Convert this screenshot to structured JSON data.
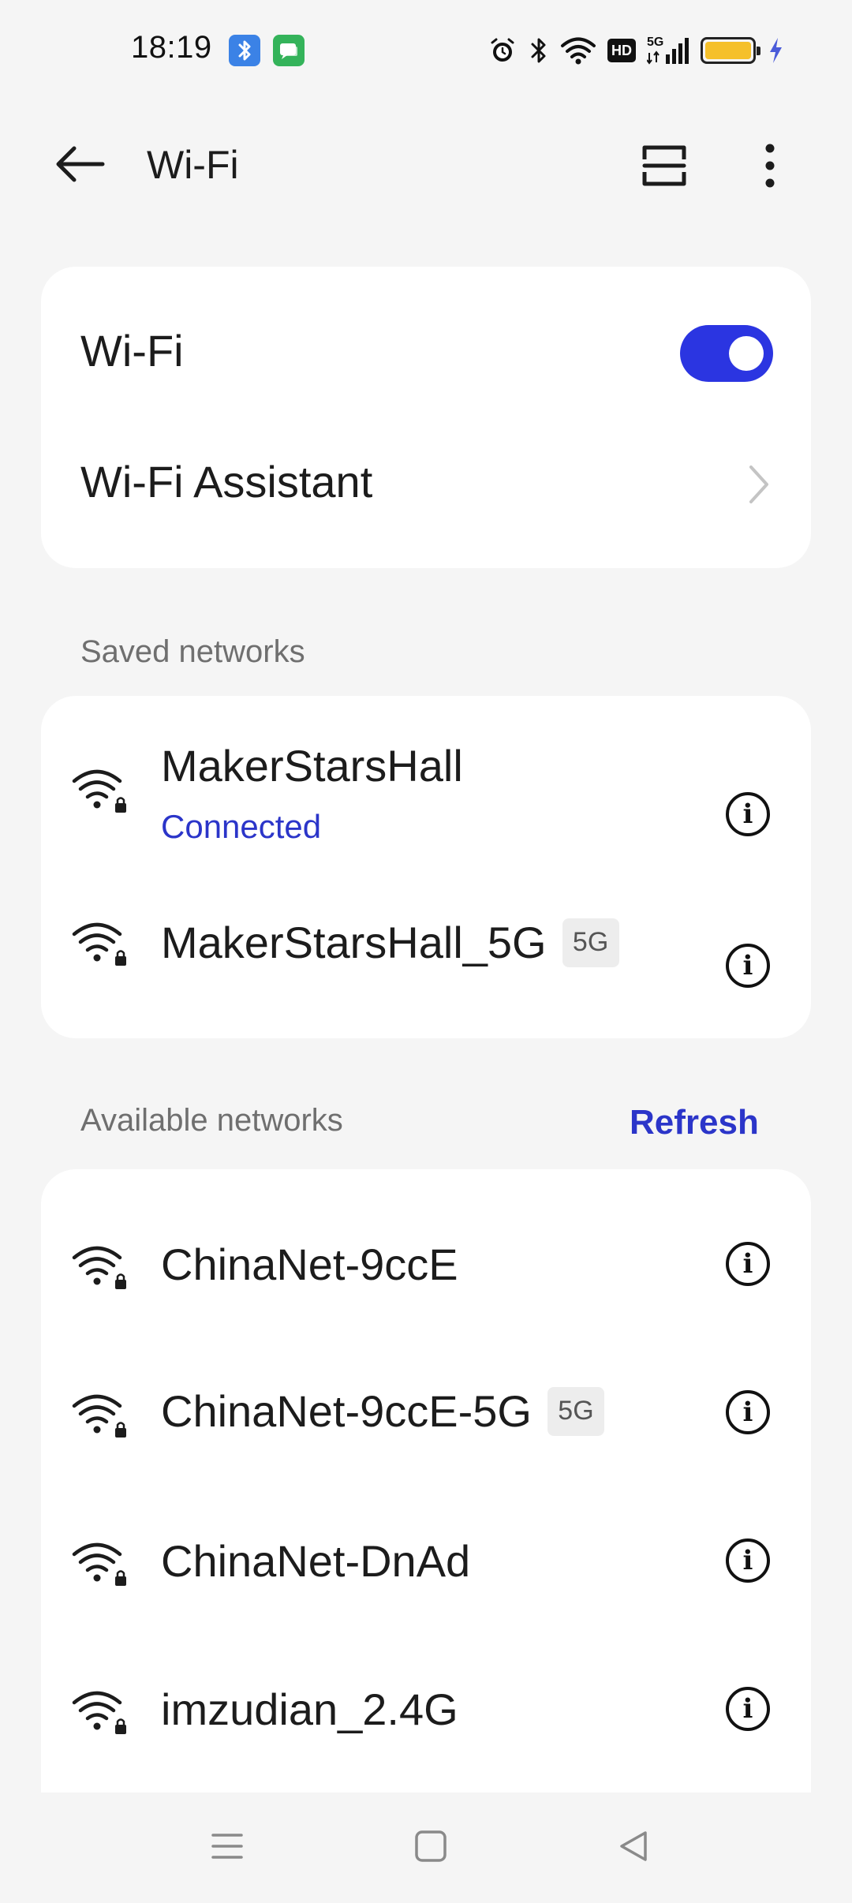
{
  "status_bar": {
    "time": "18:19",
    "app_icons": [
      "bluetooth-app-icon",
      "messages-app-icon"
    ],
    "system_icons": [
      "alarm-icon",
      "bluetooth-icon",
      "wifi-icon",
      "hd-icon",
      "5g-signal-icon",
      "battery-icon",
      "charging-icon"
    ],
    "hd_label": "HD",
    "network_label": "5G",
    "battery_color": "#f5c02a"
  },
  "appbar": {
    "title": "Wi-Fi",
    "back_icon": "arrow-left-icon",
    "scan_icon": "scan-icon",
    "more_icon": "more-vertical-icon"
  },
  "wifi_card": {
    "wifi_label": "Wi-Fi",
    "wifi_enabled": true,
    "assistant_label": "Wi-Fi Assistant"
  },
  "saved_networks": {
    "header": "Saved networks",
    "items": [
      {
        "name": "MakerStarsHall",
        "status": "Connected",
        "band": ""
      },
      {
        "name": "MakerStarsHall_5G",
        "status": "",
        "band": "5G"
      }
    ]
  },
  "available_networks": {
    "header": "Available networks",
    "refresh_label": "Refresh",
    "items": [
      {
        "name": "ChinaNet-9ccE",
        "band": ""
      },
      {
        "name": "ChinaNet-9ccE-5G",
        "band": "5G"
      },
      {
        "name": "ChinaNet-DnAd",
        "band": ""
      },
      {
        "name": "imzudian_2.4G",
        "band": ""
      }
    ]
  },
  "info_glyph": "i",
  "colors": {
    "accent": "#2b35e1",
    "link": "#2b35c9",
    "background": "#f5f5f5",
    "card": "#ffffff"
  },
  "navbar": {
    "buttons": [
      "menu-icon",
      "home-icon",
      "back-triangle-icon"
    ]
  }
}
